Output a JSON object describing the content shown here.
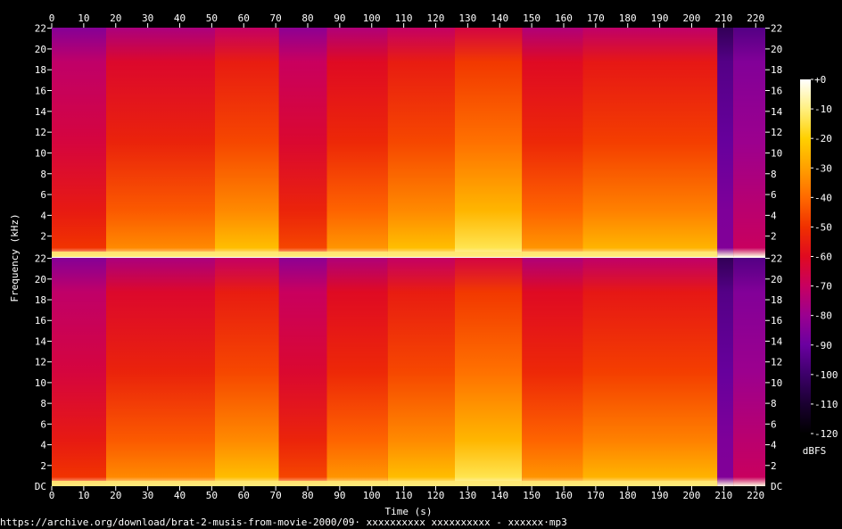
{
  "chart_data": {
    "type": "heatmap",
    "xlabel": "Time (s)",
    "ylabel": "Frequency (kHz)",
    "xlim": [
      0,
      223
    ],
    "ylim": [
      0,
      22.05
    ],
    "x_ticks": [
      0,
      10,
      20,
      30,
      40,
      50,
      60,
      70,
      80,
      90,
      100,
      110,
      120,
      130,
      140,
      150,
      160,
      170,
      180,
      190,
      200,
      210,
      220
    ],
    "y_ticks": [
      2,
      4,
      6,
      8,
      10,
      12,
      14,
      16,
      18,
      20,
      22
    ],
    "y_bottom_label": "DC",
    "channels": 2,
    "colorbar": {
      "label": "dBFS",
      "range": [
        -120,
        0
      ],
      "ticks": [
        "+0",
        "-10",
        "-20",
        "-30",
        "-40",
        "-50",
        "-60",
        "-70",
        "-80",
        "-90",
        "-100",
        "-110",
        "-120"
      ],
      "colors": [
        "#000000",
        "#1a0030",
        "#3d006a",
        "#6a00a0",
        "#9a0090",
        "#c80060",
        "#e00a20",
        "#f03000",
        "#ff6a00",
        "#ffa000",
        "#ffd000",
        "#fff080",
        "#ffffff"
      ]
    },
    "segments": [
      {
        "start": 0,
        "end": 17,
        "level": 0.55
      },
      {
        "start": 17,
        "end": 51,
        "level": 0.7
      },
      {
        "start": 51,
        "end": 71,
        "level": 0.8
      },
      {
        "start": 71,
        "end": 86,
        "level": 0.58
      },
      {
        "start": 86,
        "end": 105,
        "level": 0.72
      },
      {
        "start": 105,
        "end": 126,
        "level": 0.8
      },
      {
        "start": 126,
        "end": 147,
        "level": 0.9
      },
      {
        "start": 147,
        "end": 166,
        "level": 0.72
      },
      {
        "start": 166,
        "end": 208,
        "level": 0.78
      },
      {
        "start": 208,
        "end": 213,
        "level": 0.2
      },
      {
        "start": 213,
        "end": 223,
        "level": 0.35
      }
    ]
  },
  "caption": "https://archive.org/download/brat-2-musis-from-movie-2000/09· xxxxxxxxxx xxxxxxxxxx - xxxxxx·mp3"
}
